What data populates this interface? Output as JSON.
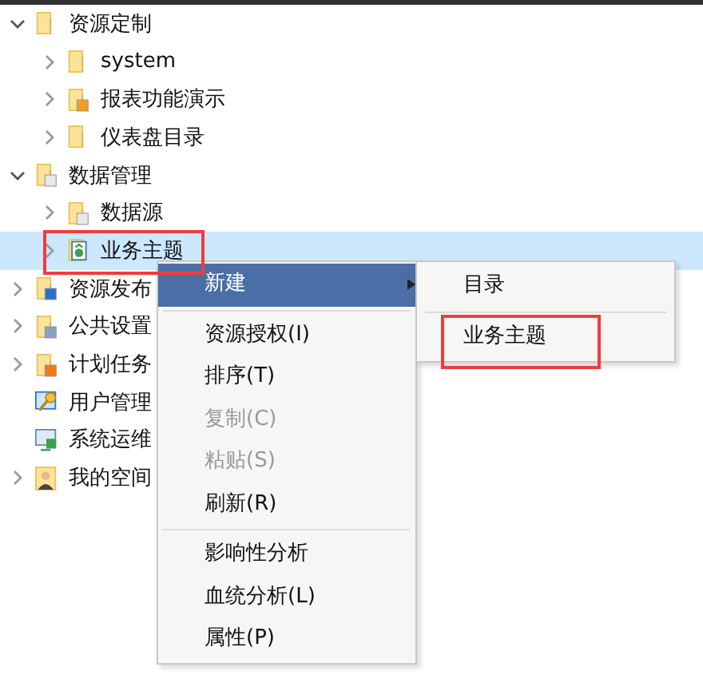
{
  "tree": [
    {
      "label": "资源定制",
      "kind": "folder",
      "expandable": true,
      "expanded": true,
      "selected": false,
      "children": [
        {
          "label": "system",
          "kind": "folder",
          "expandable": true,
          "expanded": false,
          "selected": false
        },
        {
          "label": "报表功能演示",
          "kind": "report",
          "expandable": true,
          "expanded": false,
          "selected": false
        },
        {
          "label": "仪表盘目录",
          "kind": "folder",
          "expandable": true,
          "expanded": false,
          "selected": false
        }
      ]
    },
    {
      "label": "数据管理",
      "kind": "data",
      "expandable": true,
      "expanded": true,
      "selected": false,
      "children": [
        {
          "label": "数据源",
          "kind": "data",
          "expandable": true,
          "expanded": false,
          "selected": false
        },
        {
          "label": "业务主题",
          "kind": "subject",
          "expandable": true,
          "expanded": false,
          "selected": true,
          "outlined": true
        }
      ]
    },
    {
      "label": "资源发布",
      "kind": "publish",
      "expandable": true,
      "expanded": false,
      "selected": false
    },
    {
      "label": "公共设置",
      "kind": "settings",
      "expandable": true,
      "expanded": false,
      "selected": false
    },
    {
      "label": "计划任务",
      "kind": "task",
      "expandable": true,
      "expanded": false,
      "selected": false
    },
    {
      "label": "用户管理",
      "kind": "users",
      "expandable": false,
      "selected": false
    },
    {
      "label": "系统运维",
      "kind": "system",
      "expandable": false,
      "selected": false
    },
    {
      "label": "我的空间",
      "kind": "space",
      "expandable": true,
      "expanded": false,
      "selected": false
    }
  ],
  "context_menu": [
    {
      "kind": "submenu",
      "label": "新建",
      "selected": true,
      "disabled": false
    },
    {
      "kind": "separator"
    },
    {
      "kind": "item",
      "label": "资源授权(I)",
      "selected": false,
      "disabled": false
    },
    {
      "kind": "item",
      "label": "排序(T)",
      "selected": false,
      "disabled": false
    },
    {
      "kind": "item",
      "label": "复制(C)",
      "selected": false,
      "disabled": true
    },
    {
      "kind": "item",
      "label": "粘贴(S)",
      "selected": false,
      "disabled": true
    },
    {
      "kind": "item",
      "label": "刷新(R)",
      "selected": false,
      "disabled": false
    },
    {
      "kind": "separator"
    },
    {
      "kind": "item",
      "label": "影响性分析",
      "selected": false,
      "disabled": false
    },
    {
      "kind": "item",
      "label": "血统分析(L)",
      "selected": false,
      "disabled": false
    },
    {
      "kind": "item",
      "label": "属性(P)",
      "selected": false,
      "disabled": false
    }
  ],
  "submenu": [
    {
      "kind": "item",
      "label": "目录",
      "selected": false
    },
    {
      "kind": "separator"
    },
    {
      "kind": "item",
      "label": "业务主题",
      "selected": false,
      "outlined": true
    }
  ]
}
